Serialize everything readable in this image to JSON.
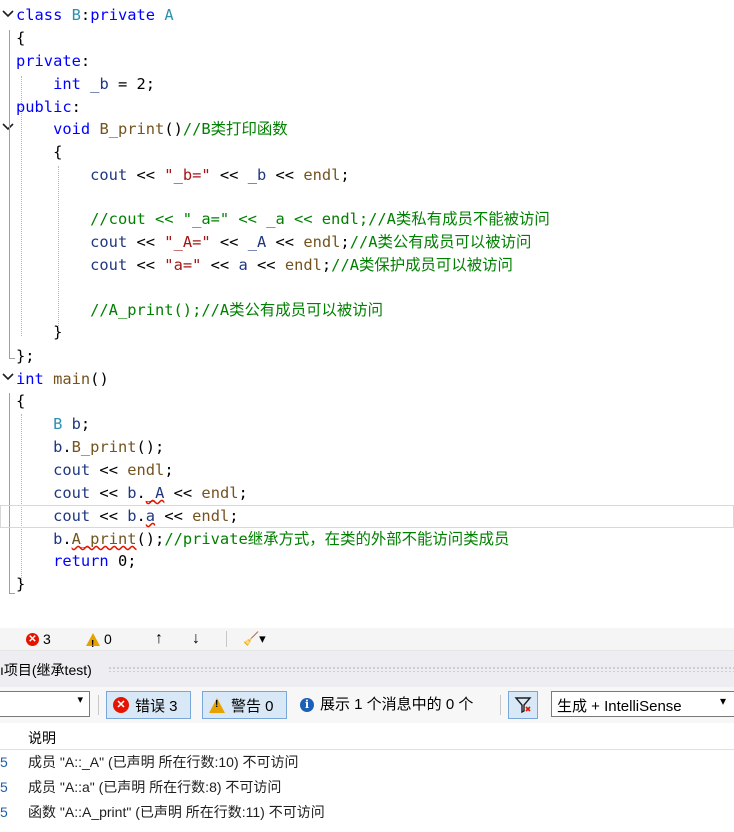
{
  "editor": {
    "lines": [
      [
        "class B:private A"
      ],
      [
        "{"
      ],
      [
        "private:"
      ],
      [
        "int _b = 2;"
      ],
      [
        "public:"
      ],
      [
        "void B_print()//B类打印函数"
      ],
      [
        "{"
      ],
      [
        "cout << \"_b=\" << _b << endl;"
      ],
      [
        ""
      ],
      [
        "//cout << \"_a=\" << _a << endl;//A类私有成员不能被访问"
      ],
      [
        "cout << \"_A=\" << _A << endl;//A类公有成员可以被访问"
      ],
      [
        "cout << \"a=\" << a << endl;//A类保护成员可以被访问"
      ],
      [
        ""
      ],
      [
        "//A_print();//A类公有成员可以被访问"
      ],
      [
        "}"
      ],
      [
        "};"
      ],
      [
        "int main()"
      ],
      [
        "{"
      ],
      [
        "B b;"
      ],
      [
        "b.B_print();"
      ],
      [
        "cout << endl;"
      ],
      [
        "cout << b._A << endl;"
      ],
      [
        "cout << b.a << endl;"
      ],
      [
        "b.A_print();//private继承方式，在类的外部不能访问类成员"
      ],
      [
        "return 0;"
      ],
      [
        "}"
      ]
    ]
  },
  "toolbar": {
    "errors": "3",
    "warnings": "0",
    "up_arrow": "↑",
    "down_arrow": "↓",
    "brush": "🧹▾"
  },
  "panel": {
    "title": "ı项目(继承test)"
  },
  "filterbar": {
    "errors_label": "错误 3",
    "warnings_label": "警告 0",
    "messages_label": "展示 1 个消息中的 0 个",
    "source_value": "生成 + IntelliSense"
  },
  "error_list": {
    "header_desc": "说明",
    "rows": [
      {
        "num": "5",
        "desc": "成员 \"A::_A\" (已声明 所在行数:10) 不可访问"
      },
      {
        "num": "5",
        "desc": "成员 \"A::a\" (已声明 所在行数:8) 不可访问"
      },
      {
        "num": "5",
        "desc": "函数 \"A::A_print\" (已声明 所在行数:11) 不可访问"
      }
    ]
  },
  "colors": {
    "keyword": "#0000ff",
    "type": "#2b91af",
    "string": "#a31515",
    "comment": "#008000",
    "error": "#e51400",
    "warning": "#e8a200",
    "info": "#1c5fb7"
  }
}
